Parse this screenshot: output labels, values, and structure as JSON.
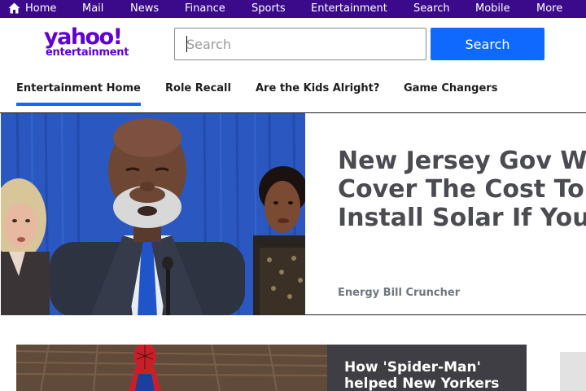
{
  "topnav": {
    "items": [
      {
        "label": "Home",
        "icon": "home-icon"
      },
      {
        "label": "Mail"
      },
      {
        "label": "News"
      },
      {
        "label": "Finance"
      },
      {
        "label": "Sports"
      },
      {
        "label": "Entertainment"
      },
      {
        "label": "Search"
      },
      {
        "label": "Mobile"
      },
      {
        "label": "More"
      }
    ],
    "bg_color": "#3b0a8a"
  },
  "logo": {
    "brand": "yahoo!",
    "section": "entertainment",
    "color": "#6001d2"
  },
  "search": {
    "placeholder": "Search",
    "value": "",
    "button_label": "Search",
    "button_color": "#0f69ff"
  },
  "subnav": {
    "items": [
      {
        "label": "Entertainment Home",
        "active": true
      },
      {
        "label": "Role Recall"
      },
      {
        "label": "Are the Kids Alright?"
      },
      {
        "label": "Game Changers"
      }
    ]
  },
  "hero": {
    "title_lines": [
      "New Jersey Gov W",
      "Cover The Cost To",
      "Install Solar If You"
    ],
    "source": "Energy Bill Cruncher"
  },
  "card2": {
    "title_lines": [
      "How 'Spider-Man'",
      "helped New Yorkers"
    ]
  }
}
